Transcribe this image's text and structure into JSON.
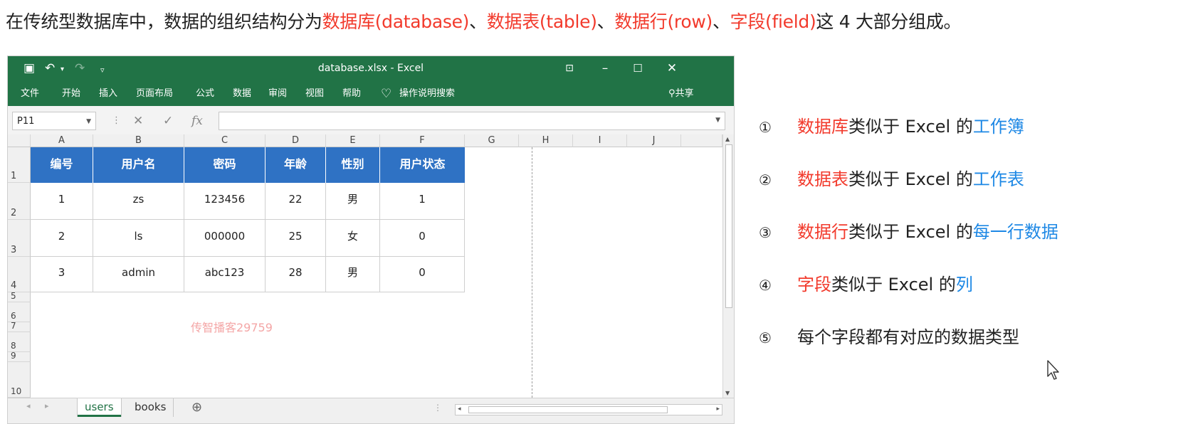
{
  "headline": {
    "prefix": "在传统型数据库中，数据的组织结构分为",
    "db": "数据库(database)",
    "sep1": "、",
    "table": "数据表(table)",
    "sep2": "、",
    "row": "数据行(row)",
    "sep3": "、",
    "field": "字段(field)",
    "suffix": "这 4 大部分组成。"
  },
  "excel": {
    "doc_title": "database.xlsx - Excel",
    "menu": [
      "文件",
      "开始",
      "插入",
      "页面布局",
      "公式",
      "数据",
      "审阅",
      "视图",
      "帮助"
    ],
    "search_label": "操作说明搜索",
    "share_label": "共享",
    "name_box": "P11",
    "fx_label": "fx",
    "columns": [
      "A",
      "B",
      "C",
      "D",
      "E",
      "F",
      "G",
      "H",
      "I",
      "J"
    ],
    "row_numbers": [
      "1",
      "2",
      "3",
      "4",
      "5",
      "6",
      "7",
      "8",
      "9",
      "10"
    ],
    "table_headers": [
      "编号",
      "用户名",
      "密码",
      "年龄",
      "性别",
      "用户状态"
    ],
    "rows": [
      [
        "1",
        "zs",
        "123456",
        "22",
        "男",
        "1"
      ],
      [
        "2",
        "ls",
        "000000",
        "25",
        "女",
        "0"
      ],
      [
        "3",
        "admin",
        "abc123",
        "28",
        "男",
        "0"
      ]
    ],
    "watermark": "传智播客29759",
    "sheet_tabs": [
      "users",
      "books"
    ],
    "add_sheet": "⊕"
  },
  "notes": [
    {
      "num": "①",
      "red": "数据库",
      "mid": "类似于 Excel 的",
      "blue": "工作簿"
    },
    {
      "num": "②",
      "red": "数据表",
      "mid": "类似于 Excel 的",
      "blue": "工作表"
    },
    {
      "num": "③",
      "red": "数据行",
      "mid": "类似于 Excel 的",
      "blue": "每一行数据"
    },
    {
      "num": "④",
      "red": "字段",
      "mid": "类似于 Excel 的",
      "blue": "列"
    },
    {
      "num": "⑤",
      "red": "",
      "mid": "每个字段都有对应的数据类型",
      "blue": ""
    }
  ],
  "colors": {
    "excel_green": "#217346",
    "header_blue": "#2f72c4",
    "accent_red": "#f23a2c",
    "accent_blue": "#1e88e5"
  }
}
